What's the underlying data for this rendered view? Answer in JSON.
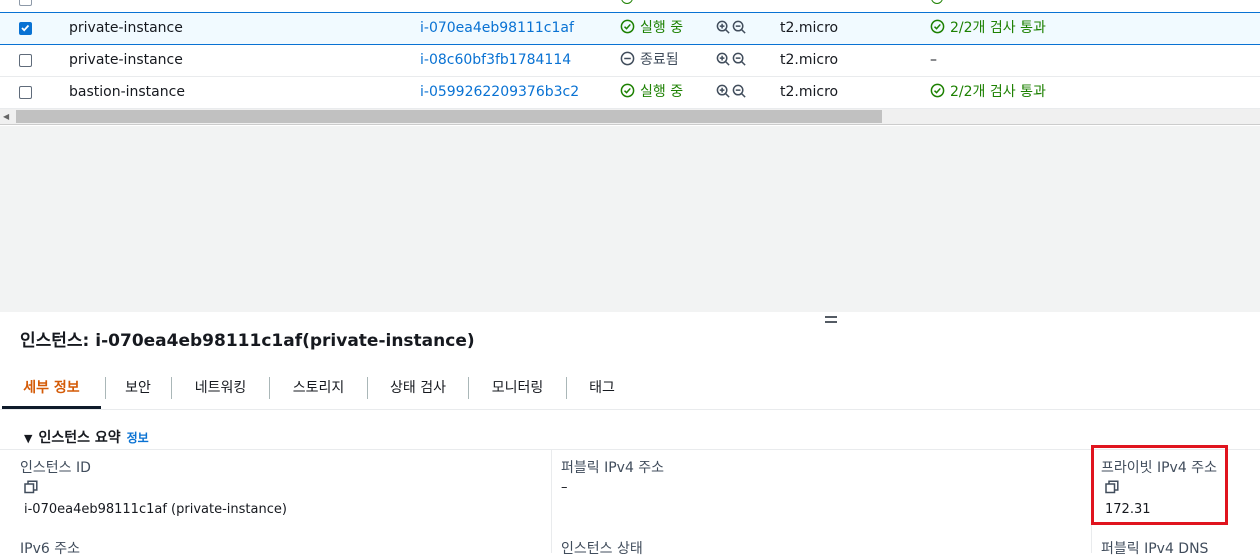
{
  "table": {
    "rows": [
      {
        "name": "private-instance",
        "id": "i-070ea4eb98111c1af",
        "state": "실행 중",
        "type": "t2.micro",
        "checks": "2/2개 검사 통과",
        "selected": true,
        "running": true
      },
      {
        "name": "private-instance",
        "id": "i-08c60bf3fb1784114",
        "state": "종료됨",
        "type": "t2.micro",
        "checks": "–",
        "selected": false,
        "running": false
      },
      {
        "name": "bastion-instance",
        "id": "i-0599262209376b3c2",
        "state": "실행 중",
        "type": "t2.micro",
        "checks": "2/2개 검사 통과",
        "selected": false,
        "running": true
      }
    ]
  },
  "details": {
    "title": "인스턴스: i-070ea4eb98111c1af(private-instance)",
    "tabs": [
      "세부 정보",
      "보안",
      "네트워킹",
      "스토리지",
      "상태 검사",
      "모니터링",
      "태그"
    ],
    "active_tab": "세부 정보",
    "section_title": "인스턴스 요약",
    "section_info": "정보",
    "fields": {
      "instance_id_label": "인스턴스 ID",
      "instance_id_value": "i-070ea4eb98111c1af (private-instance)",
      "public_ipv4_label": "퍼블릭 IPv4 주소",
      "public_ipv4_value": "–",
      "private_ipv4_label": "프라이빗 IPv4 주소",
      "private_ipv4_value": "172.31",
      "ipv6_label": "IPv6 주소",
      "instance_state_label": "인스턴스 상태",
      "public_dns_label": "퍼블릭 IPv4 DNS"
    }
  },
  "colors": {
    "link": "#0972d3",
    "success": "#1d8102",
    "active_tab": "#d45b07",
    "highlight": "#e0141e"
  }
}
